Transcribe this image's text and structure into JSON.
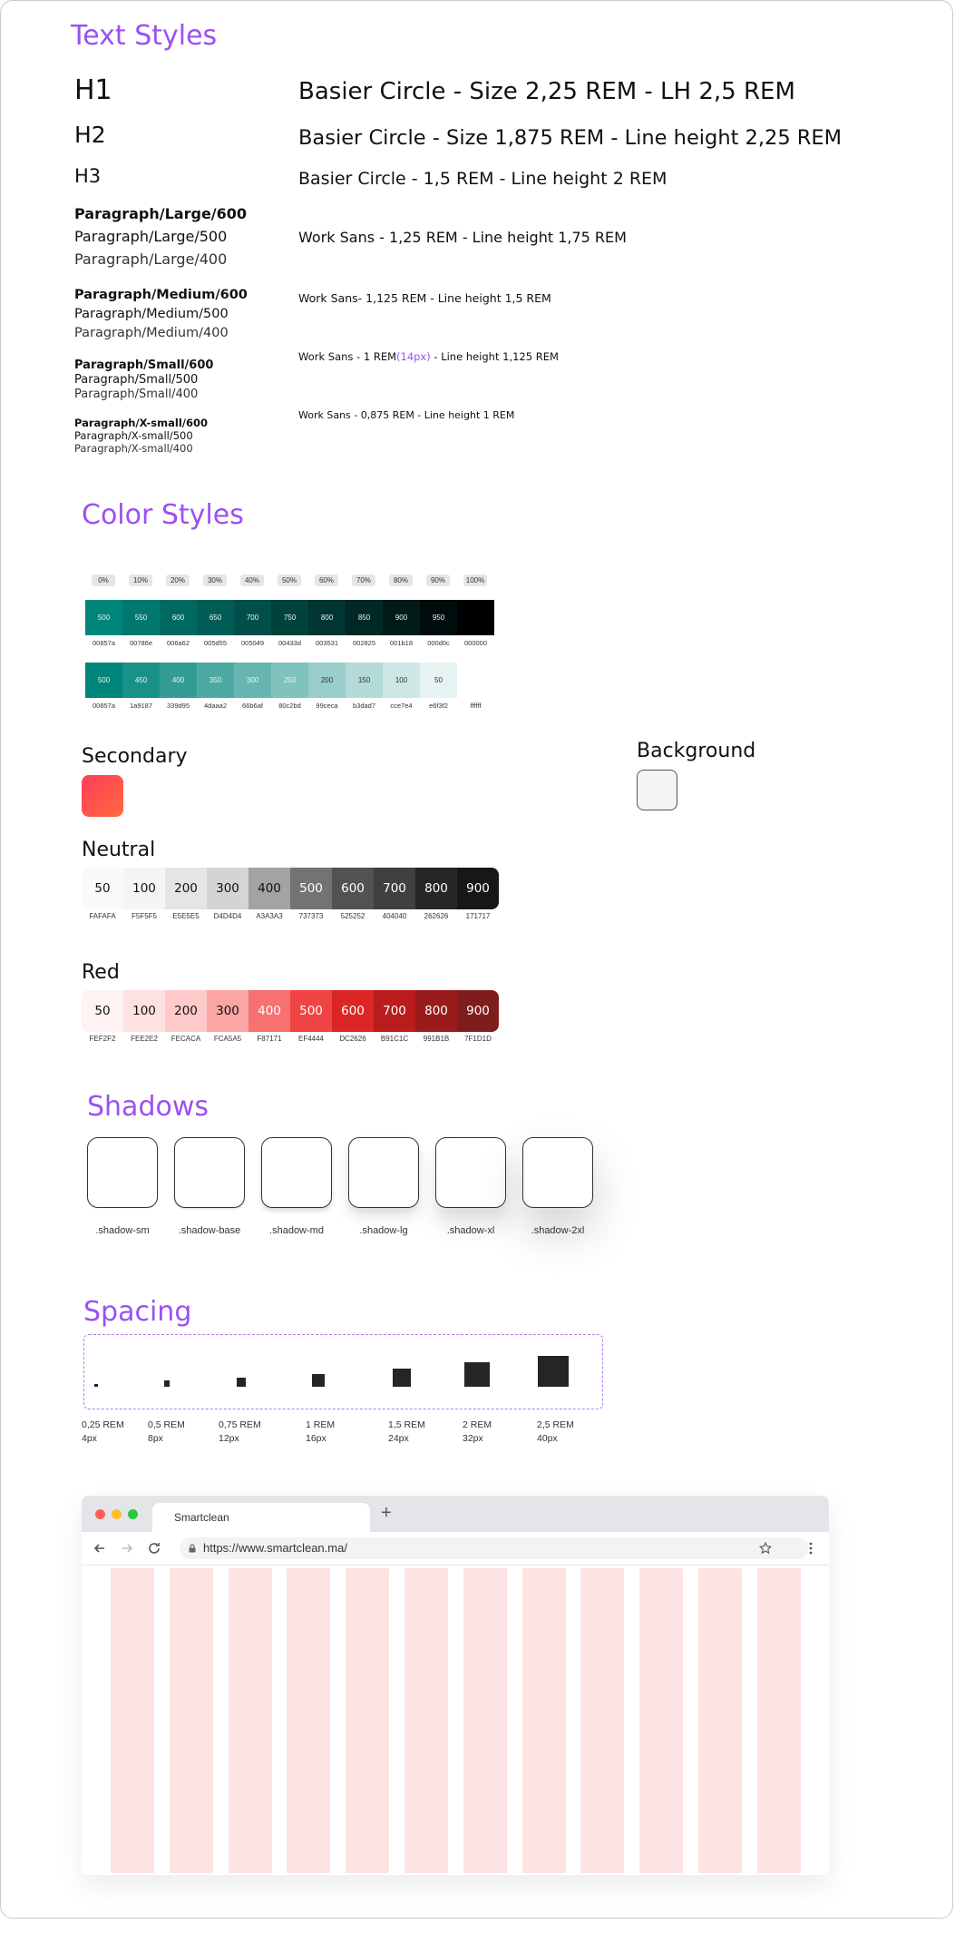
{
  "sections": {
    "text_styles": "Text Styles",
    "color_styles": "Color Styles",
    "shadows": "Shadows",
    "spacing": "Spacing"
  },
  "text_styles": [
    {
      "name": "H1",
      "desc": "Basier Circle - Size 2,25 REM - LH 2,5 REM"
    },
    {
      "name": "H2",
      "desc": "Basier Circle -  Size 1,875 REM - Line height 2,25 REM"
    },
    {
      "name": "H3",
      "desc": "Basier Circle - 1,5 REM - Line height 2 REM"
    },
    {
      "name": "Paragraph/Large/600"
    },
    {
      "name": "Paragraph/Large/500",
      "desc": "Work Sans - 1,25 REM - Line height 1,75 REM"
    },
    {
      "name": "Paragraph/Large/400"
    },
    {
      "name": "Paragraph/Medium/600"
    },
    {
      "name": "Paragraph/Medium/500",
      "desc": "Work Sans- 1,125 REM - Line height 1,5 REM"
    },
    {
      "name": "Paragraph/Medium/400"
    },
    {
      "name": "Paragraph/Small/600"
    },
    {
      "name": "Paragraph/Small/500",
      "desc_pre": "Work Sans - 1 REM",
      "desc_highlight": "(14px)",
      "desc_post": " - Line height 1,125 REM"
    },
    {
      "name": "Paragraph/Small/400"
    },
    {
      "name": "Paragraph/X-small/600"
    },
    {
      "name": "Paragraph/X-small/500",
      "desc": "Work Sans - 0,875 REM - Line height 1 REM"
    },
    {
      "name": "Paragraph/X-small/400"
    }
  ],
  "opacity_tags": [
    "0%",
    "10%",
    "20%",
    "30%",
    "40%",
    "50%",
    "60%",
    "70%",
    "80%",
    "90%",
    "100%"
  ],
  "primary_dark": [
    {
      "label": "500",
      "hex": "00857a",
      "color": "#00857a"
    },
    {
      "label": "550",
      "hex": "00786e",
      "color": "#00786e"
    },
    {
      "label": "600",
      "hex": "006a62",
      "color": "#006a62"
    },
    {
      "label": "650",
      "hex": "005d55",
      "color": "#005d55"
    },
    {
      "label": "700",
      "hex": "005049",
      "color": "#005049"
    },
    {
      "label": "750",
      "hex": "00433d",
      "color": "#00433d"
    },
    {
      "label": "800",
      "hex": "003531",
      "color": "#003531"
    },
    {
      "label": "850",
      "hex": "002825",
      "color": "#002825"
    },
    {
      "label": "900",
      "hex": "001b18",
      "color": "#001b18"
    },
    {
      "label": "950",
      "hex": "000d0c",
      "color": "#000d0c"
    },
    {
      "label": "",
      "hex": "000000",
      "color": "#000000"
    }
  ],
  "primary_light": [
    {
      "label": "500",
      "hex": "00857a",
      "color": "#00857a"
    },
    {
      "label": "450",
      "hex": "1a9187",
      "color": "#1a9187"
    },
    {
      "label": "400",
      "hex": "339d95",
      "color": "#339d95"
    },
    {
      "label": "350",
      "hex": "4daaa2",
      "color": "#4daaa2"
    },
    {
      "label": "300",
      "hex": "66b6af",
      "color": "#66b6af"
    },
    {
      "label": "250",
      "hex": "80c2bd",
      "color": "#80c2bd"
    },
    {
      "label": "200",
      "hex": "99ceca",
      "color": "#99ceca"
    },
    {
      "label": "150",
      "hex": "b3dad7",
      "color": "#b3dad7"
    },
    {
      "label": "100",
      "hex": "cce7e4",
      "color": "#cce7e4"
    },
    {
      "label": "50",
      "hex": "e6f3f2",
      "color": "#e6f3f2"
    },
    {
      "label": "",
      "hex": "ffffff",
      "color": "#ffffff"
    }
  ],
  "secondary": {
    "title": "Secondary",
    "color_from": "#ff3d5a",
    "color_to": "#ff6a3d"
  },
  "background": {
    "title": "Background",
    "color": "#f3f4f6"
  },
  "neutral": {
    "title": "Neutral",
    "swatches": [
      {
        "label": "50",
        "hex": "FAFAFA",
        "color": "#fafafa",
        "text": "#111"
      },
      {
        "label": "100",
        "hex": "F5F5F5",
        "color": "#f5f5f5",
        "text": "#111"
      },
      {
        "label": "200",
        "hex": "E5E5E5",
        "color": "#e5e5e5",
        "text": "#111"
      },
      {
        "label": "300",
        "hex": "D4D4D4",
        "color": "#d4d4d4",
        "text": "#111"
      },
      {
        "label": "400",
        "hex": "A3A3A3",
        "color": "#a3a3a3",
        "text": "#111"
      },
      {
        "label": "500",
        "hex": "737373",
        "color": "#737373",
        "text": "#fff"
      },
      {
        "label": "600",
        "hex": "525252",
        "color": "#525252",
        "text": "#fff"
      },
      {
        "label": "700",
        "hex": "404040",
        "color": "#404040",
        "text": "#fff"
      },
      {
        "label": "800",
        "hex": "262626",
        "color": "#262626",
        "text": "#fff"
      },
      {
        "label": "900",
        "hex": "171717",
        "color": "#171717",
        "text": "#fff"
      }
    ]
  },
  "red": {
    "title": "Red",
    "swatches": [
      {
        "label": "50",
        "hex": "FEF2F2",
        "color": "#fef2f2",
        "text": "#111"
      },
      {
        "label": "100",
        "hex": "FEE2E2",
        "color": "#fee2e2",
        "text": "#111"
      },
      {
        "label": "200",
        "hex": "FECACA",
        "color": "#fecaca",
        "text": "#111"
      },
      {
        "label": "300",
        "hex": "FCA5A5",
        "color": "#fca5a5",
        "text": "#111"
      },
      {
        "label": "400",
        "hex": "F87171",
        "color": "#f87171",
        "text": "#fff"
      },
      {
        "label": "500",
        "hex": "EF4444",
        "color": "#ef4444",
        "text": "#fff"
      },
      {
        "label": "600",
        "hex": "DC2626",
        "color": "#dc2626",
        "text": "#fff"
      },
      {
        "label": "700",
        "hex": "B91C1C",
        "color": "#b91c1c",
        "text": "#fff"
      },
      {
        "label": "800",
        "hex": "991B1B",
        "color": "#991b1b",
        "text": "#fff"
      },
      {
        "label": "900",
        "hex": "7F1D1D",
        "color": "#7f1d1d",
        "text": "#fff"
      }
    ]
  },
  "shadows": [
    ".shadow-sm",
    ".shadow-base",
    ".shadow-md",
    ".shadow-lg",
    ".shadow-xl",
    ".shadow-2xl"
  ],
  "spacing": [
    {
      "rem": "0,25 REM",
      "px": "4px"
    },
    {
      "rem": "0,5 REM",
      "px": "8px"
    },
    {
      "rem": "0,75 REM",
      "px": "12px"
    },
    {
      "rem": "1 REM",
      "px": "16px"
    },
    {
      "rem": "1,5 REM",
      "px": "24px"
    },
    {
      "rem": "2 REM",
      "px": "32px"
    },
    {
      "rem": "2,5 REM",
      "px": "40px"
    }
  ],
  "browser": {
    "tab_title": "Smartclean",
    "new_tab": "+",
    "url": "https://www.smartclean.ma/",
    "icons": [
      "back-icon",
      "forward-icon",
      "reload-icon",
      "lock-icon",
      "star-icon",
      "menu-icon"
    ]
  },
  "colors": {
    "accent": "#9b51f2",
    "grid_column": "#fde4e4"
  }
}
